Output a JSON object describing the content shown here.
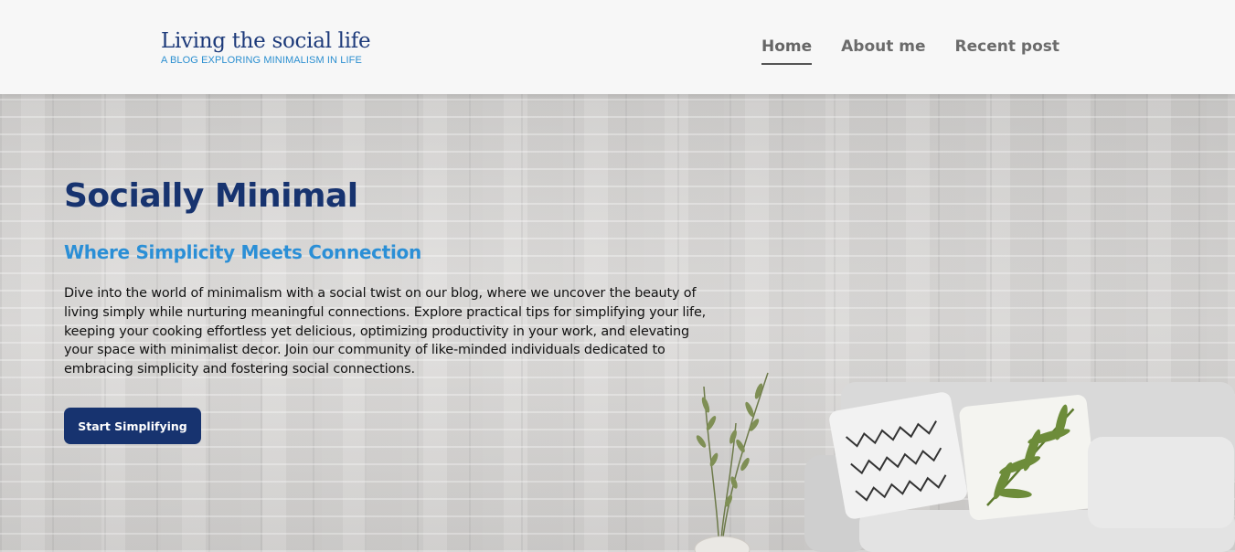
{
  "header": {
    "site_title": "Living the social life",
    "tagline": "A BLOG EXPLORING MINIMALISM IN LIFE",
    "nav": [
      {
        "label": "Home",
        "active": true
      },
      {
        "label": "About me",
        "active": false
      },
      {
        "label": "Recent post",
        "active": false
      }
    ]
  },
  "hero": {
    "title": "Socially Minimal",
    "subtitle": "Where Simplicity Meets Connection",
    "body": "Dive into the world of minimalism with a social twist on our blog, where we uncover the beauty of living simply while nurturing meaningful connections. Explore practical tips for simplifying your life, keeping your cooking effortless yet delicious, optimizing productivity in your work, and elevating your space with minimalist decor. Join our community of like-minded individuals dedicated to embracing simplicity and fostering social connections.",
    "cta_label": "Start Simplifying"
  },
  "colors": {
    "brand_navy": "#17336f",
    "accent_blue": "#2b8fd6",
    "header_bg": "#f7f7f7",
    "nav_text": "#6b6b6b"
  },
  "icons": {
    "decor": [
      "plant-image",
      "sofa-image"
    ]
  }
}
